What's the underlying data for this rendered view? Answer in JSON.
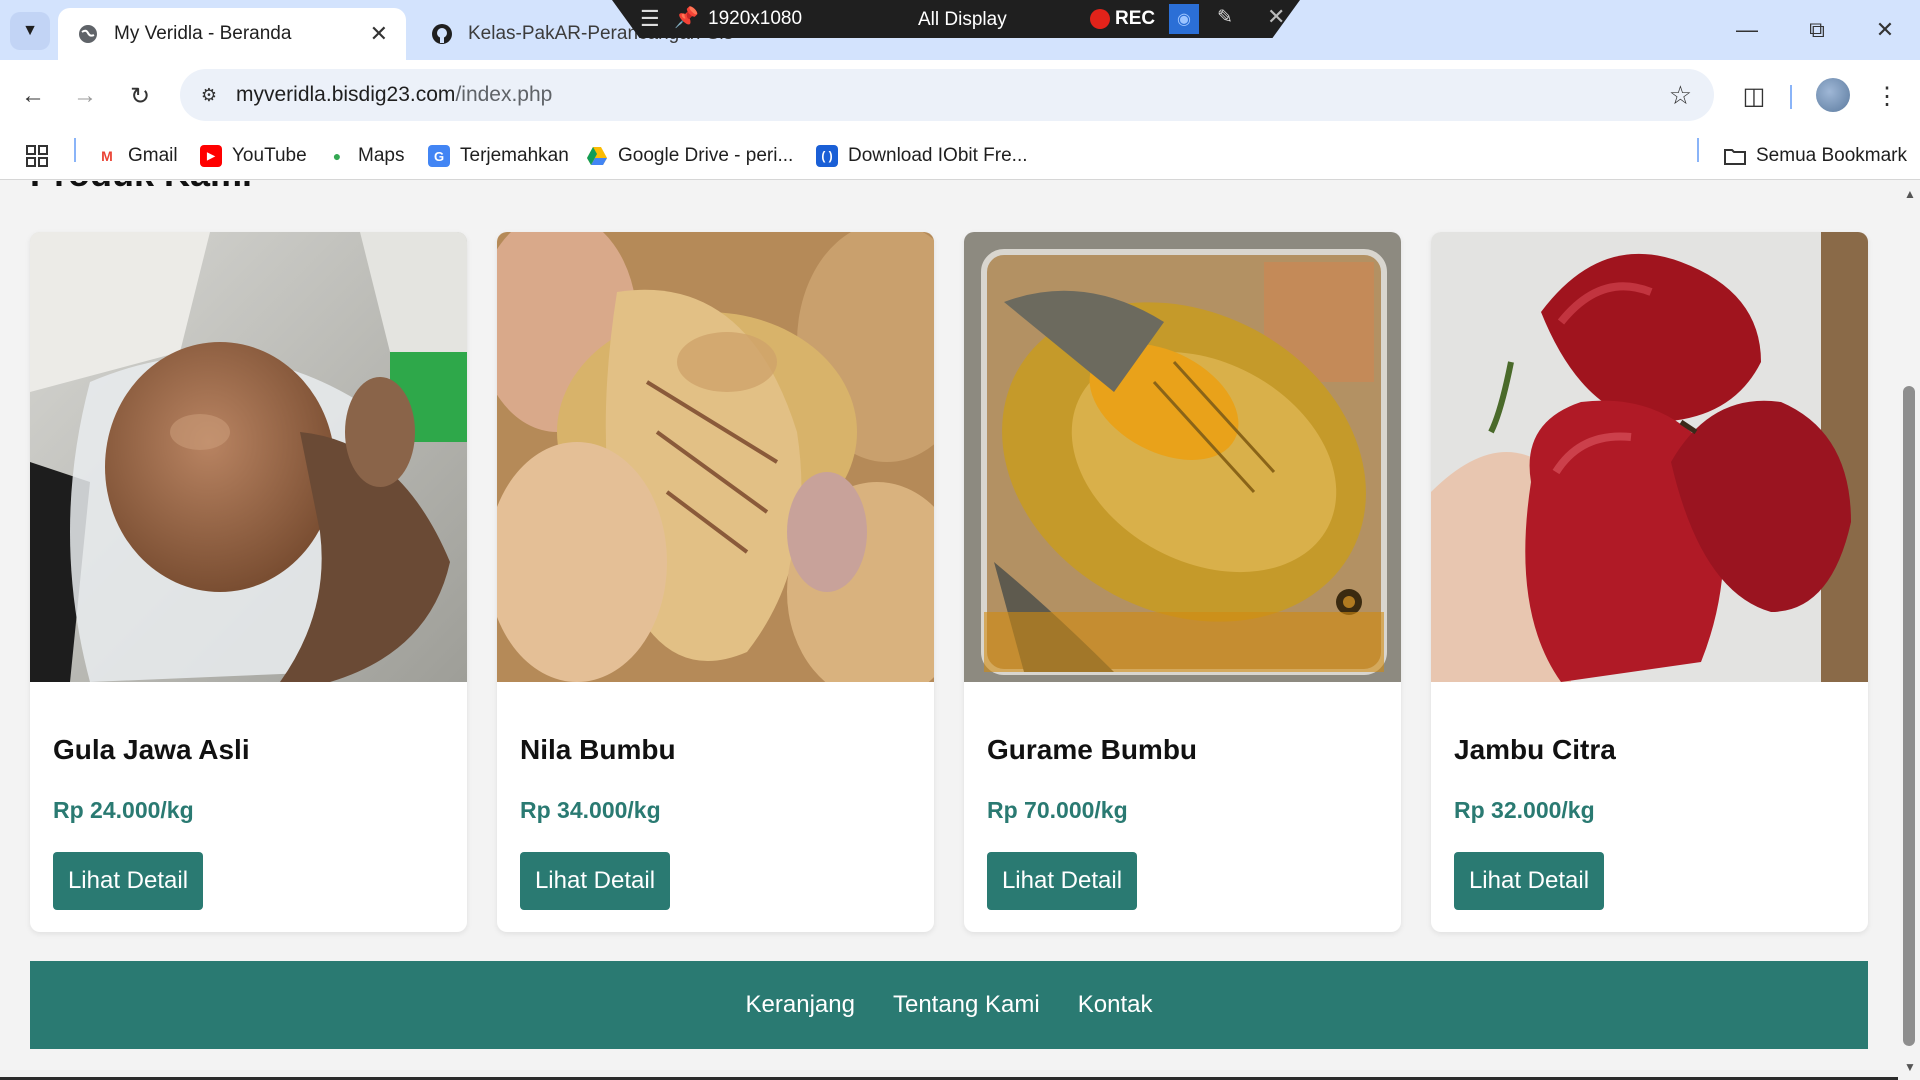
{
  "browser": {
    "tabs": [
      {
        "title": "My Veridla - Beranda",
        "active": true,
        "icon": "globe-icon"
      },
      {
        "title": "Kelas-PakAR-Perancangan-Sistem-Informasi",
        "active": false,
        "icon": "github-icon"
      }
    ],
    "address": {
      "domain": "myveridla.bisdig23.com",
      "path": "/index.php"
    },
    "bookmarks": [
      {
        "label": "Gmail",
        "icon": "gmail-icon"
      },
      {
        "label": "YouTube",
        "icon": "youtube-icon"
      },
      {
        "label": "Maps",
        "icon": "maps-icon"
      },
      {
        "label": "Terjemahkan",
        "icon": "translate-icon"
      },
      {
        "label": "Google Drive - peri...",
        "icon": "drive-icon"
      },
      {
        "label": "Download IObit Fre...",
        "icon": "iobit-icon"
      }
    ],
    "all_bookmarks_label": "Semua Bookmark"
  },
  "recorder": {
    "resolution": "1920x1080",
    "display": "All Display",
    "rec_label": "REC"
  },
  "page": {
    "section_title": "Produk Kami",
    "products": [
      {
        "name": "Gula Jawa Asli",
        "price": "Rp 24.000/kg",
        "button": "Lihat Detail"
      },
      {
        "name": "Nila Bumbu",
        "price": "Rp 34.000/kg",
        "button": "Lihat Detail"
      },
      {
        "name": "Gurame Bumbu",
        "price": "Rp 70.000/kg",
        "button": "Lihat Detail"
      },
      {
        "name": "Jambu Citra",
        "price": "Rp 32.000/kg",
        "button": "Lihat Detail"
      }
    ],
    "footer_links": [
      "Keranjang",
      "Tentang Kami",
      "Kontak"
    ]
  },
  "colors": {
    "accent": "#2a7a72",
    "tabbar": "#d3e3fd",
    "page_bg": "#f3f3f3"
  }
}
